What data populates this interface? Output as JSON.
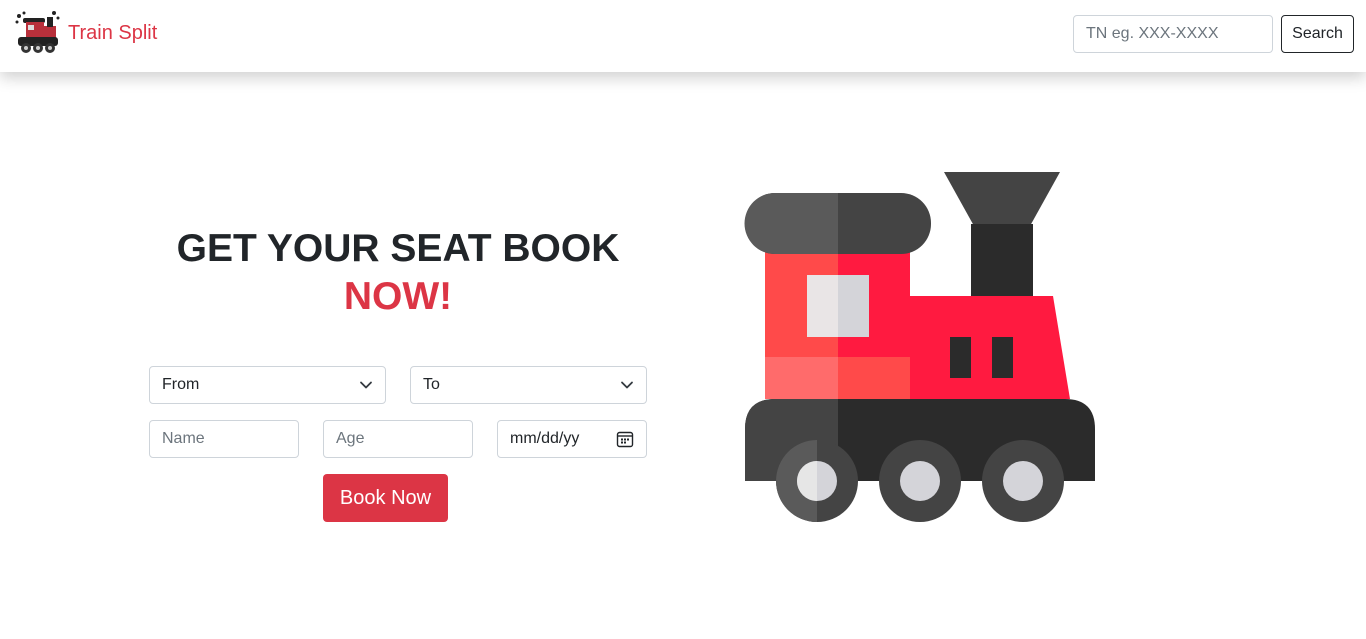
{
  "navbar": {
    "brand_name": "Train Split",
    "brand_icon": "steam-locomotive-logo-icon",
    "search": {
      "placeholder": "TN eg. XXX-XXXX",
      "value": ""
    },
    "search_button_label": "Search"
  },
  "hero": {
    "title_line1": "GET YOUR SEAT BOOK",
    "title_line2": "NOW!"
  },
  "form": {
    "from_select": {
      "selected": "From"
    },
    "to_select": {
      "selected": "To"
    },
    "name_field": {
      "placeholder": "Name"
    },
    "age_field": {
      "placeholder": "Age"
    },
    "date_field": {
      "value": "mm/dd/yy"
    },
    "book_button_label": "Book Now"
  },
  "illustration": {
    "icon": "locomotive-illustration"
  },
  "colors": {
    "accent": "#dc3545",
    "text_dark": "#212529",
    "border": "#ced4da",
    "placeholder": "#6c757d",
    "train_red": "#ff1a40",
    "train_dark": "#2b2b2b"
  }
}
